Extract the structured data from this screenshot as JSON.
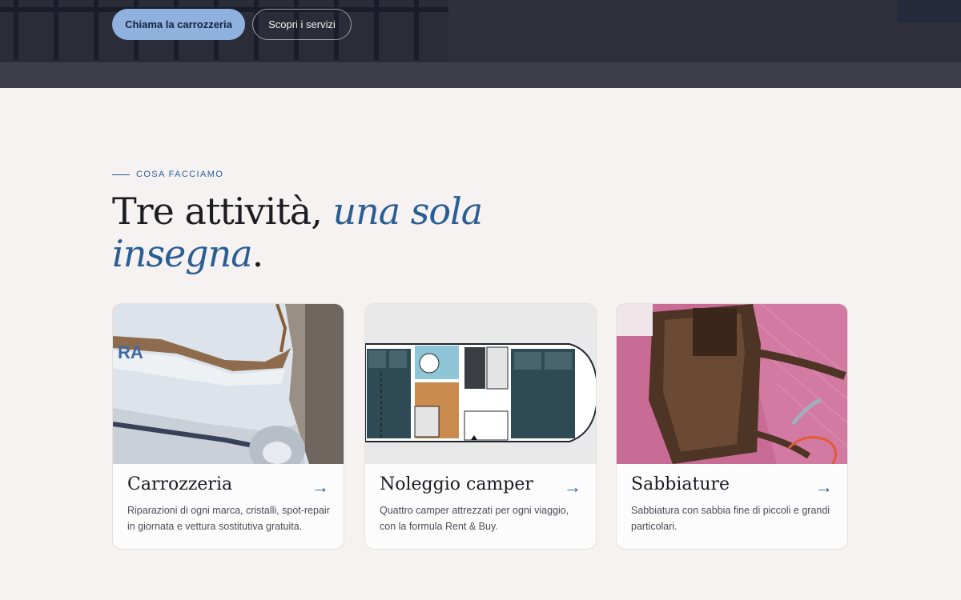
{
  "hero": {
    "primary_button": "Chiama la carrozzeria",
    "secondary_button": "Scopri i servizi"
  },
  "section": {
    "eyebrow": "COSA FACCIAMO",
    "headline_part1": "Tre attività, ",
    "headline_accent": "una sola insegna",
    "headline_end": "."
  },
  "cards": [
    {
      "title": "Carrozzeria",
      "description": "Riparazioni di ogni marca, cristalli, spot-repair in giornata e vettura sostitutiva gratuita.",
      "arrow": "→",
      "icon": "damaged-vehicle-photo"
    },
    {
      "title": "Noleggio camper",
      "description": "Quattro camper attrezzati per ogni viaggio, con la formula Rent & Buy.",
      "arrow": "→",
      "icon": "camper-floorplan-photo"
    },
    {
      "title": "Sabbiature",
      "description": "Sabbiatura con sabbia fine di piccoli e grandi particolari.",
      "arrow": "→",
      "icon": "sandblasted-furniture-photo"
    }
  ],
  "colors": {
    "accent": "#2a5d93",
    "primary_button": "#8fb1dd",
    "background": "#f5f2f1"
  }
}
